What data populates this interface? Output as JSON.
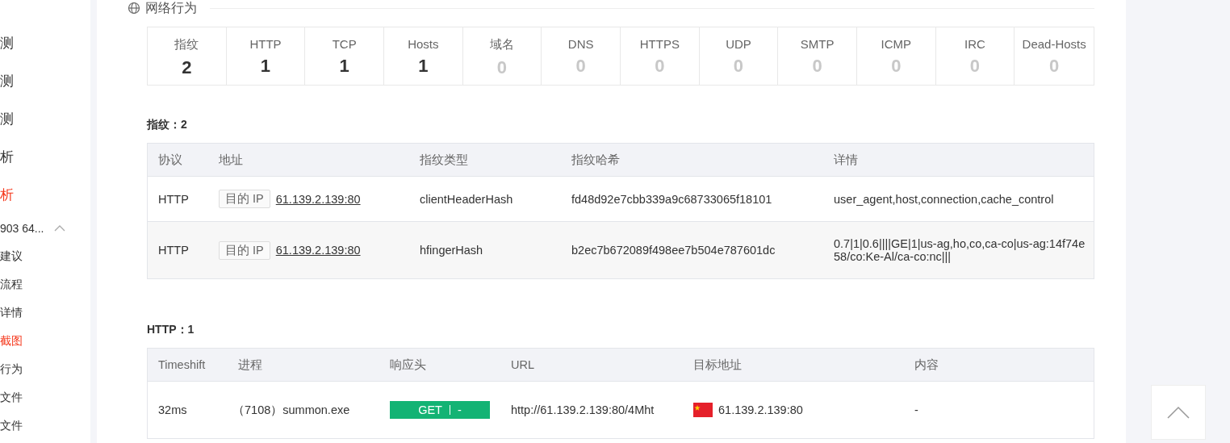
{
  "sidebar": {
    "items": [
      {
        "label": "测",
        "selected": false
      },
      {
        "label": "测",
        "selected": false
      },
      {
        "label": "测",
        "selected": false
      },
      {
        "label": "析",
        "selected": false
      },
      {
        "label": "析",
        "selected": true
      },
      {
        "label": "903 64...",
        "selected": false,
        "expanded": true
      },
      {
        "label": "建议",
        "selected": false
      },
      {
        "label": "流程",
        "selected": false
      },
      {
        "label": "详情",
        "selected": false
      },
      {
        "label": "截图",
        "selected": true
      },
      {
        "label": "行为",
        "selected": false
      },
      {
        "label": "文件",
        "selected": false
      },
      {
        "label": "文件",
        "selected": false
      }
    ]
  },
  "section": {
    "title": "网络行为"
  },
  "stats": [
    {
      "label": "指纹",
      "value": "2",
      "empty": false
    },
    {
      "label": "HTTP",
      "value": "1",
      "empty": false
    },
    {
      "label": "TCP",
      "value": "1",
      "empty": false
    },
    {
      "label": "Hosts",
      "value": "1",
      "empty": false
    },
    {
      "label": "域名",
      "value": "0",
      "empty": true
    },
    {
      "label": "DNS",
      "value": "0",
      "empty": true
    },
    {
      "label": "HTTPS",
      "value": "0",
      "empty": true
    },
    {
      "label": "UDP",
      "value": "0",
      "empty": true
    },
    {
      "label": "SMTP",
      "value": "0",
      "empty": true
    },
    {
      "label": "ICMP",
      "value": "0",
      "empty": true
    },
    {
      "label": "IRC",
      "value": "0",
      "empty": true
    },
    {
      "label": "Dead-Hosts",
      "value": "0",
      "empty": true
    }
  ],
  "fingerprint_table": {
    "title": "指纹：2",
    "columns": [
      "协议",
      "地址",
      "指纹类型",
      "指纹哈希",
      "详情"
    ],
    "rows": [
      {
        "protocol": "HTTP",
        "tag": "目的 IP",
        "address": "61.139.2.139:80",
        "type": "clientHeaderHash",
        "hash": "fd48d92e7cbb339a9c68733065f18101",
        "detail": "user_agent,host,connection,cache_control",
        "hovered": false
      },
      {
        "protocol": "HTTP",
        "tag": "目的 IP",
        "address": "61.139.2.139:80",
        "type": "hfingerHash",
        "hash": "b2ec7b672089f498ee7b504e787601dc",
        "detail": "0.7|1|0.6||||GE|1|us-ag,ho,co,ca-co|us-ag:14f74e58/co:Ke-Al/ca-co:nc|||",
        "hovered": true
      }
    ]
  },
  "http_table": {
    "title": "HTTP：1",
    "columns": [
      "Timeshift",
      "进程",
      "响应头",
      "URL",
      "目标地址",
      "内容"
    ],
    "rows": [
      {
        "timeshift": "32ms",
        "process": "（7108）summon.exe",
        "method": "GET",
        "status": "-",
        "url": "http://61.139.2.139:80/4Mht",
        "target": "61.139.2.139:80",
        "content": "-"
      }
    ]
  }
}
